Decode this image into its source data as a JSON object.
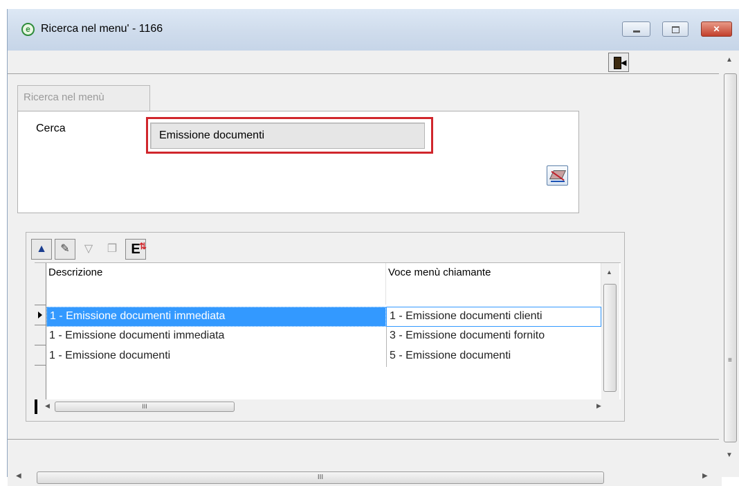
{
  "window": {
    "title": "Ricerca nel menu' - 1166",
    "minimize_glyph": "",
    "maximize_glyph": "",
    "close_glyph": "✕"
  },
  "tab": {
    "label": "Ricerca nel menù"
  },
  "search": {
    "label": "Cerca",
    "value": "Emissione documenti"
  },
  "grid": {
    "columns": [
      "Descrizione",
      "Voce menù chiamante"
    ],
    "rows": [
      {
        "descrizione": "1 - Emissione documenti immediata",
        "voce": "1 - Emissione documenti clienti",
        "selected": true
      },
      {
        "descrizione": "1 - Emissione documenti immediata",
        "voce": "3 - Emissione documenti fornito",
        "selected": false
      },
      {
        "descrizione": "1 - Emissione documenti",
        "voce": "5 - Emissione documenti",
        "selected": false
      }
    ],
    "hscroll_grip": "III"
  },
  "scroll": {
    "hgrip": "III",
    "vgrip": "≡"
  },
  "colors": {
    "highlight": "#d0262c",
    "selection": "#3399ff"
  },
  "icons": [
    "app-logo-icon",
    "exit-door-icon",
    "clear-eraser-icon",
    "up-arrow-icon",
    "edit-icon",
    "filter-icon",
    "copy-icon",
    "export-excel-icon"
  ]
}
